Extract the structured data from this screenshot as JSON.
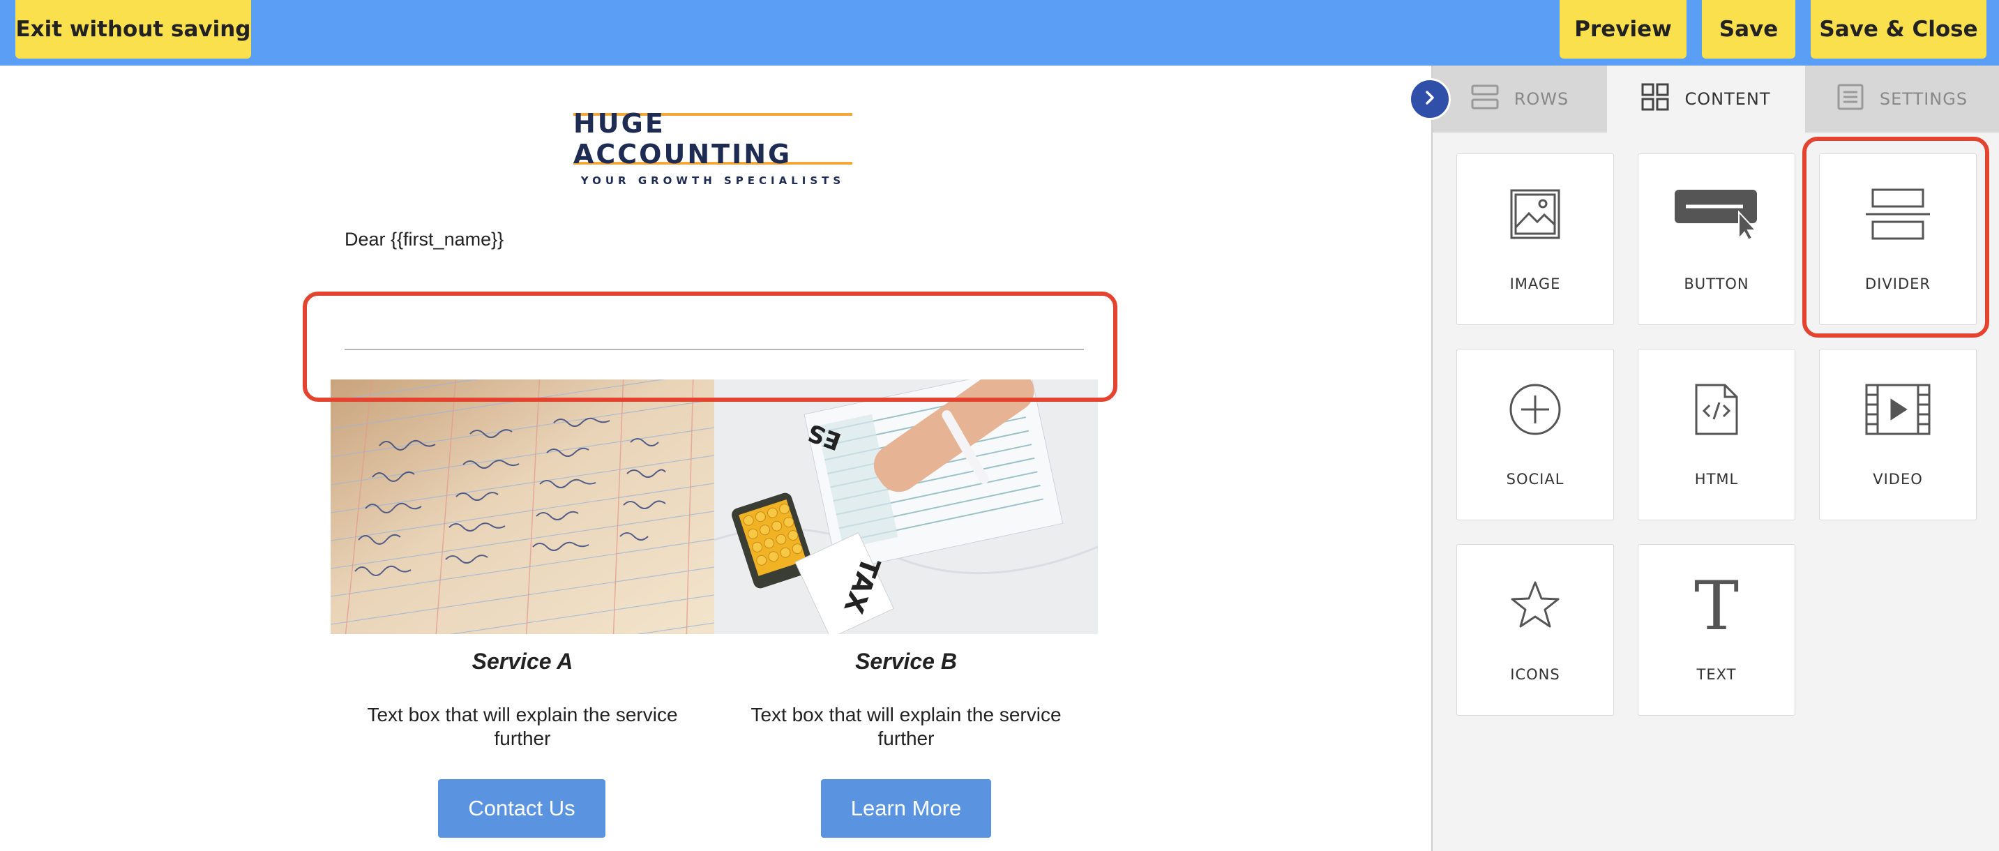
{
  "toolbar": {
    "exit_label": "Exit without saving",
    "preview_label": "Preview",
    "save_label": "Save",
    "save_close_label": "Save & Close"
  },
  "email": {
    "logo_title": "HUGE ACCOUNTING",
    "logo_subtitle": "YOUR GROWTH SPECIALISTS",
    "greeting": "Dear {{first_name}}",
    "service_a": {
      "title": "Service A",
      "text": "Text box that will explain the service further",
      "button": "Contact Us"
    },
    "service_b": {
      "title": "Service B",
      "text": "Text box that will explain the service further",
      "button": "Learn More"
    },
    "image_b_texts": [
      "ES",
      "TAX"
    ]
  },
  "panel": {
    "tabs": [
      {
        "label": "ROWS",
        "icon": "rows-icon",
        "active": false
      },
      {
        "label": "CONTENT",
        "icon": "grid-icon",
        "active": true
      },
      {
        "label": "SETTINGS",
        "icon": "settings-icon",
        "active": false
      }
    ],
    "tiles": [
      {
        "label": "IMAGE",
        "icon": "image-icon"
      },
      {
        "label": "BUTTON",
        "icon": "button-icon"
      },
      {
        "label": "DIVIDER",
        "icon": "divider-icon",
        "highlighted": true
      },
      {
        "label": "SOCIAL",
        "icon": "social-icon"
      },
      {
        "label": "HTML",
        "icon": "html-icon"
      },
      {
        "label": "VIDEO",
        "icon": "video-icon"
      },
      {
        "label": "ICONS",
        "icon": "star-icon"
      },
      {
        "label": "TEXT",
        "icon": "text-icon"
      }
    ],
    "text_tile_glyph": "T"
  },
  "colors": {
    "topbar": "#5a9ef5",
    "button_yellow": "#fbe04d",
    "highlight_red": "#e3432f",
    "cta_blue": "#5a93e0",
    "logo_navy": "#1e2b52",
    "logo_orange": "#f2a83a",
    "collapse_blue": "#2f4fa8"
  }
}
